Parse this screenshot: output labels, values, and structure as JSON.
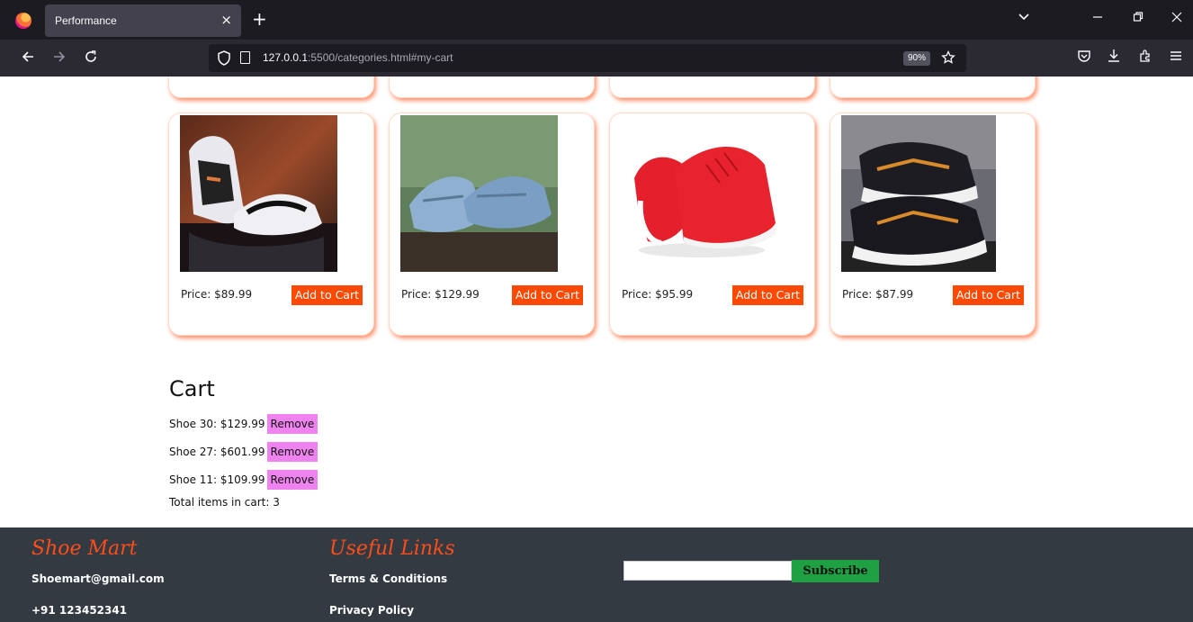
{
  "browser": {
    "tab_title": "Performance",
    "tab_close": "×",
    "new_tab": "+",
    "url_host": "127.0.0.1",
    "url_rest": ":5500/categories.html#my-cart",
    "zoom": "90%"
  },
  "products": [
    {
      "price": "Price: $89.99",
      "button": "Add to Cart",
      "image": "black-white-sneaker"
    },
    {
      "price": "Price: $129.99",
      "button": "Add to Cart",
      "image": "blue-sneaker"
    },
    {
      "price": "Price: $95.99",
      "button": "Add to Cart",
      "image": "red-sneaker"
    },
    {
      "price": "Price: $87.99",
      "button": "Add to Cart",
      "image": "black-orange-sneaker"
    }
  ],
  "cart": {
    "title": "Cart",
    "items": [
      {
        "label": "Shoe 30: $129.99",
        "remove": "Remove"
      },
      {
        "label": "Shoe 27: $601.99",
        "remove": "Remove"
      },
      {
        "label": "Shoe 11: $109.99",
        "remove": "Remove"
      }
    ],
    "total": "Total items in cart: 3"
  },
  "footer": {
    "brand": "Shoe Mart",
    "email": "Shoemart@gmail.com",
    "phone": "+91 123452341",
    "links_title": "Useful Links",
    "links": [
      "Terms & Conditions",
      "Privacy Policy"
    ],
    "subscribe_value": "",
    "subscribe_label": "Subscribe"
  },
  "colors": {
    "accent": "#ff4800",
    "remove": "#ee82ee",
    "subscribe": "#1fa043",
    "footer_bg": "#333a42"
  }
}
